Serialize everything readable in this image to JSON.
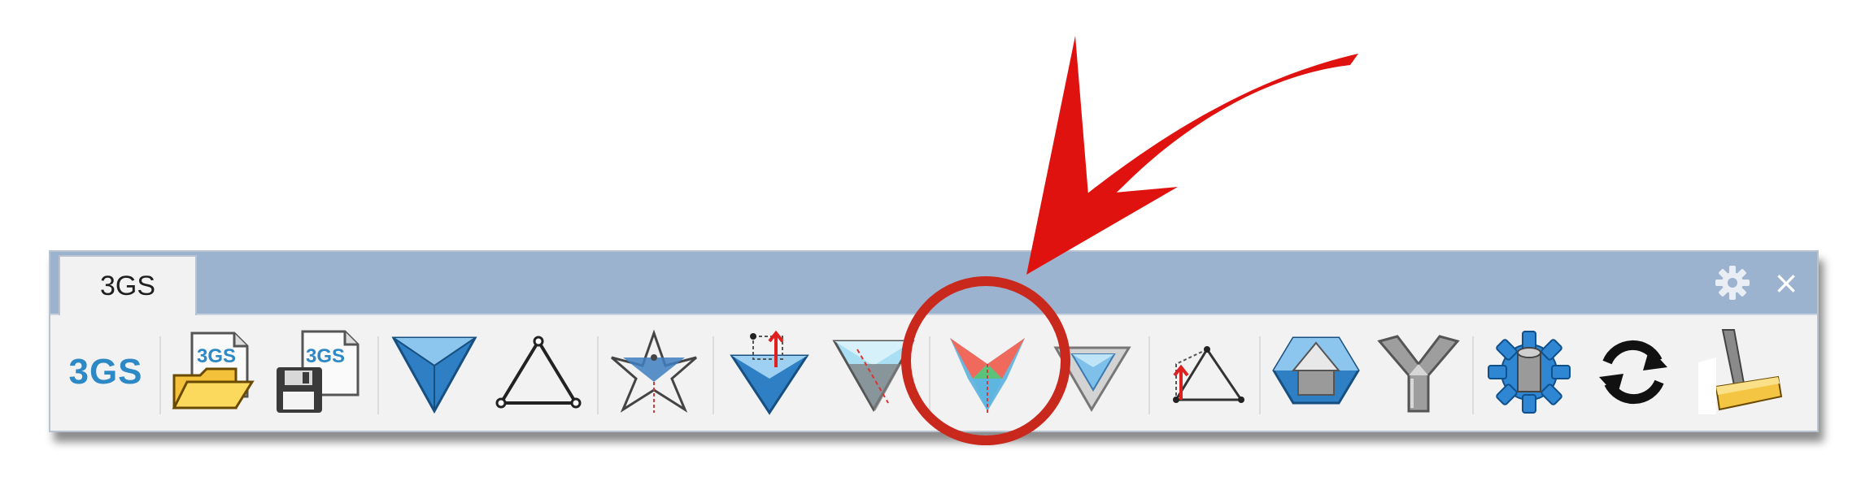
{
  "panel": {
    "tab_label": "3GS",
    "close_glyph": "×"
  },
  "toolbar": {
    "brand_label": "3GS",
    "file_badge_open": "3GS",
    "file_badge_save": "3GS",
    "icons": [
      "3gs-logo-icon",
      "open-file-icon",
      "save-file-icon",
      "inverted-triangle-icon",
      "triangle-outline-icon",
      "star-vertex-icon",
      "force-triangle-icon",
      "dual-triangle-icon",
      "trifold-triangle-icon",
      "nested-triangle-icon",
      "triangle-dimension-icon",
      "hexagon-volume-icon",
      "node-connector-icon",
      "settings-cog-icon",
      "refresh-icon",
      "broom-icon"
    ]
  },
  "colors": {
    "tab_bar": "#9cb3cf",
    "panel_bg": "#f2f2f2",
    "brand_blue": "#2d88c6",
    "annotation_red": "#e0120f",
    "highlight_circle": "#c9281d"
  }
}
